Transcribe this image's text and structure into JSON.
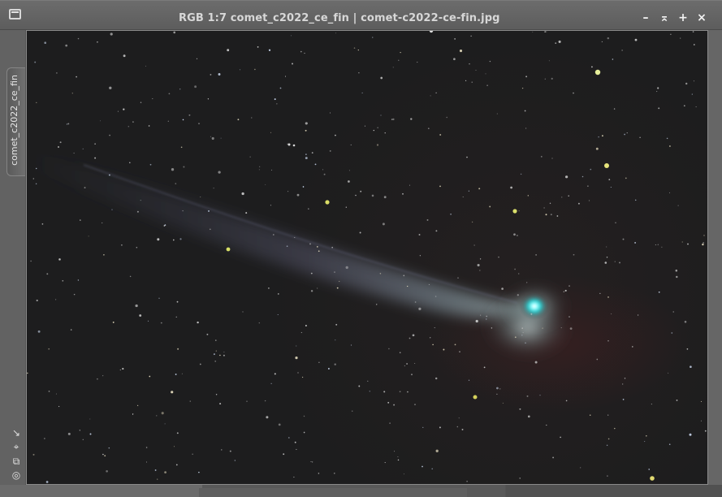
{
  "window": {
    "title": "RGB 1:7 comet_c2022_ce_fin | comet-c2022-ce-fin.jpg",
    "icon": "image-window-icon"
  },
  "side_tab": {
    "label": "comet_c2022_ce_fin"
  },
  "controls": [
    {
      "name": "minimize",
      "glyph": "–"
    },
    {
      "name": "shade",
      "glyph": "⌅"
    },
    {
      "name": "maximize",
      "glyph": "+"
    },
    {
      "name": "close",
      "glyph": "×"
    }
  ],
  "tools": [
    {
      "name": "zoom-fit",
      "glyph": "↘"
    },
    {
      "name": "fit-view",
      "glyph": "⌖"
    },
    {
      "name": "clone-view",
      "glyph": "⧉"
    },
    {
      "name": "view-options",
      "glyph": "◎"
    }
  ],
  "image": {
    "content": "comet-c2022-ce-fin",
    "colors": {
      "sky": "#1d1d1e",
      "comet_core": "#45f0ef",
      "tail": "#6e6f92",
      "nebula_tint": "#752022"
    }
  }
}
